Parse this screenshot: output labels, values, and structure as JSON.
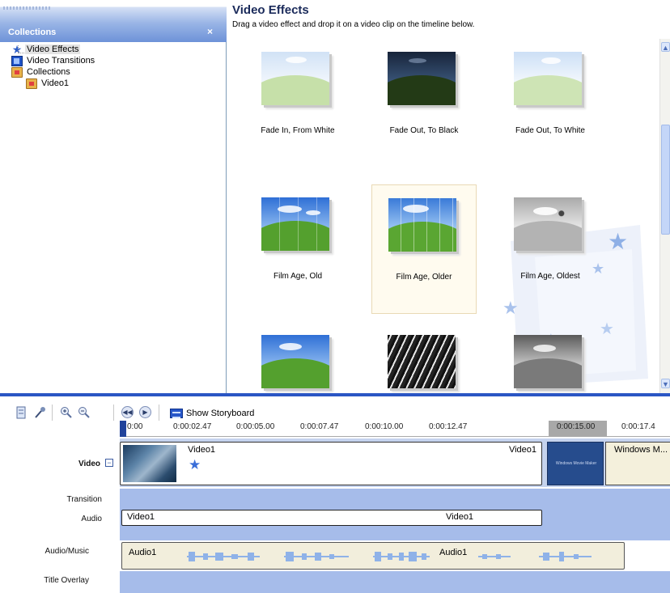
{
  "collections": {
    "title": "Collections",
    "close": "×",
    "items": [
      {
        "label": "Video Effects",
        "icon": "star-icon"
      },
      {
        "label": "Video Transitions",
        "icon": "transition-icon"
      },
      {
        "label": "Collections",
        "icon": "collections-folder-icon"
      },
      {
        "label": "Video1",
        "icon": "collection-folder-icon"
      }
    ]
  },
  "effects": {
    "title": "Video Effects",
    "description": "Drag a video effect and drop it on a video clip on the timeline below.",
    "items": [
      {
        "label": "Fade In, From White"
      },
      {
        "label": "Fade Out, To Black"
      },
      {
        "label": "Fade Out, To White"
      },
      {
        "label": "Film Age, Old"
      },
      {
        "label": "Film Age, Older"
      },
      {
        "label": "Film Age, Oldest"
      },
      {
        "label": ""
      },
      {
        "label": ""
      },
      {
        "label": ""
      }
    ],
    "selected_index": 4
  },
  "toolbar": {
    "show_storyboard": "Show Storyboard"
  },
  "timeline": {
    "ticks": [
      "0:00",
      "0:00:02.47",
      "0:00:05.00",
      "0:00:07.47",
      "0:00:10.00",
      "0:00:12.47",
      "0:00:15.00",
      "0:00:17.4"
    ],
    "tracks": {
      "video": "Video",
      "transition": "Transition",
      "audio": "Audio",
      "audio_music": "Audio/Music",
      "title_overlay": "Title Overlay"
    },
    "video_clip": {
      "title": "Video1",
      "end_label": "Video1"
    },
    "wmm_clip": {
      "text": "Windows Movie Maker"
    },
    "second_clip": {
      "label": "Windows M..."
    },
    "audio_clip": {
      "left": "Video1",
      "right": "Video1"
    },
    "music_clip": {
      "left": "Audio1",
      "right": "Audio1"
    }
  },
  "colors": {
    "accent": "#2b56c4",
    "track": "#a6bcea",
    "clip_bg": "#f2eedc"
  }
}
